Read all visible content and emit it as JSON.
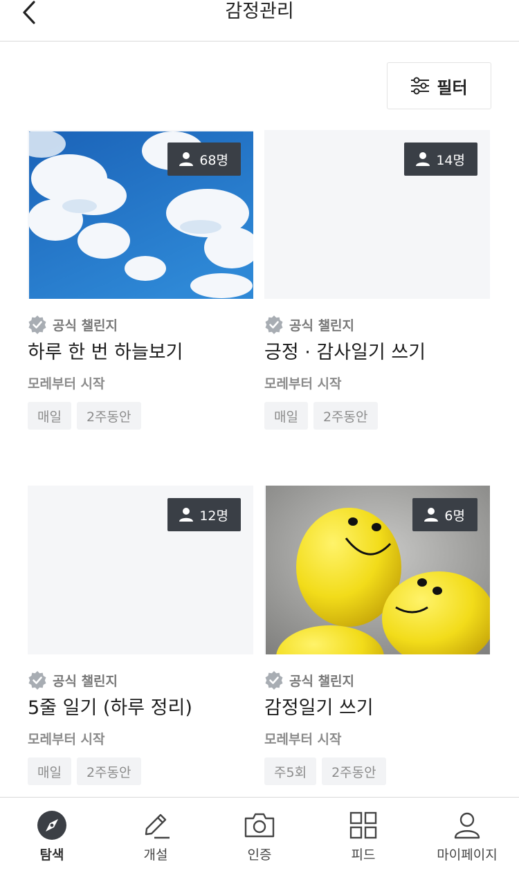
{
  "header": {
    "title": "감정관리"
  },
  "filter": {
    "label": "필터"
  },
  "cards": [
    {
      "count": "68명",
      "official": "공식 챌린지",
      "title": "하루 한 번 하늘보기",
      "start": "모레부터 시작",
      "tags": [
        "매일",
        "2주동안"
      ]
    },
    {
      "count": "14명",
      "official": "공식 챌린지",
      "title": "긍정 · 감사일기 쓰기",
      "start": "모레부터 시작",
      "tags": [
        "매일",
        "2주동안"
      ]
    },
    {
      "count": "12명",
      "official": "공식 챌린지",
      "title": "5줄 일기 (하루 정리)",
      "start": "모레부터 시작",
      "tags": [
        "매일",
        "2주동안"
      ]
    },
    {
      "count": "6명",
      "official": "공식 챌린지",
      "title": "감정일기 쓰기",
      "start": "모레부터 시작",
      "tags": [
        "주5회",
        "2주동안"
      ]
    }
  ],
  "nav": [
    {
      "label": "탐색",
      "icon": "compass-icon"
    },
    {
      "label": "개설",
      "icon": "pencil-icon"
    },
    {
      "label": "인증",
      "icon": "camera-icon"
    },
    {
      "label": "피드",
      "icon": "grid-icon"
    },
    {
      "label": "마이페이지",
      "icon": "person-icon"
    }
  ],
  "colors": {
    "badge": "#3a3f46",
    "placeholder": "#f5f6f8",
    "tag": "#f2f3f5"
  }
}
